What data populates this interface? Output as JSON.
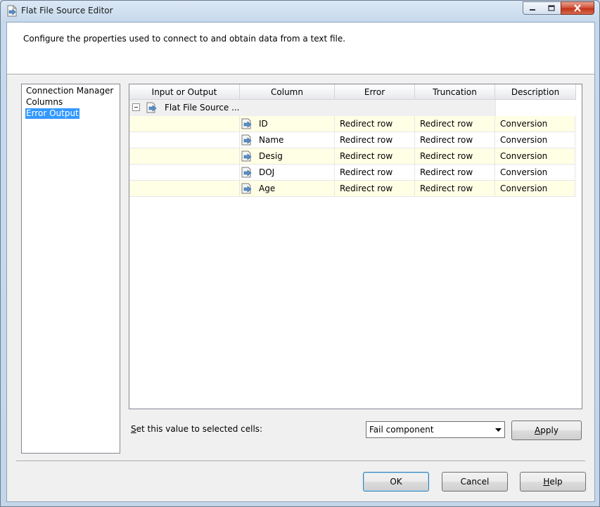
{
  "window": {
    "title": "Flat File Source Editor"
  },
  "header": {
    "description": "Configure the properties used to connect to and obtain data from a text file."
  },
  "nav": {
    "items": [
      {
        "label": "Connection Manager",
        "selected": false
      },
      {
        "label": "Columns",
        "selected": false
      },
      {
        "label": "Error Output",
        "selected": true
      }
    ]
  },
  "grid": {
    "columns": [
      "Input or Output",
      "Column",
      "Error",
      "Truncation",
      "Description"
    ],
    "parent": {
      "label": "Flat File Source ..."
    },
    "rows": [
      {
        "column": "ID",
        "error": "Redirect row",
        "truncation": "Redirect row",
        "description": "Conversion"
      },
      {
        "column": "Name",
        "error": "Redirect row",
        "truncation": "Redirect row",
        "description": "Conversion"
      },
      {
        "column": "Desig",
        "error": "Redirect row",
        "truncation": "Redirect row",
        "description": "Conversion"
      },
      {
        "column": "DOJ",
        "error": "Redirect row",
        "truncation": "Redirect row",
        "description": "Conversion"
      },
      {
        "column": "Age",
        "error": "Redirect row",
        "truncation": "Redirect row",
        "description": "Conversion"
      }
    ]
  },
  "set_value": {
    "label_prefix": "S",
    "label_rest": "et this value to selected cells:",
    "selected": "Fail component",
    "apply_prefix": "A",
    "apply_rest": "pply"
  },
  "footer": {
    "ok_label": "OK",
    "cancel_label": "Cancel",
    "help_prefix": "H",
    "help_rest": "elp"
  },
  "colors": {
    "selection": "#3399ff",
    "row_highlight": "#ffffe6",
    "close_button": "#c3341a"
  }
}
